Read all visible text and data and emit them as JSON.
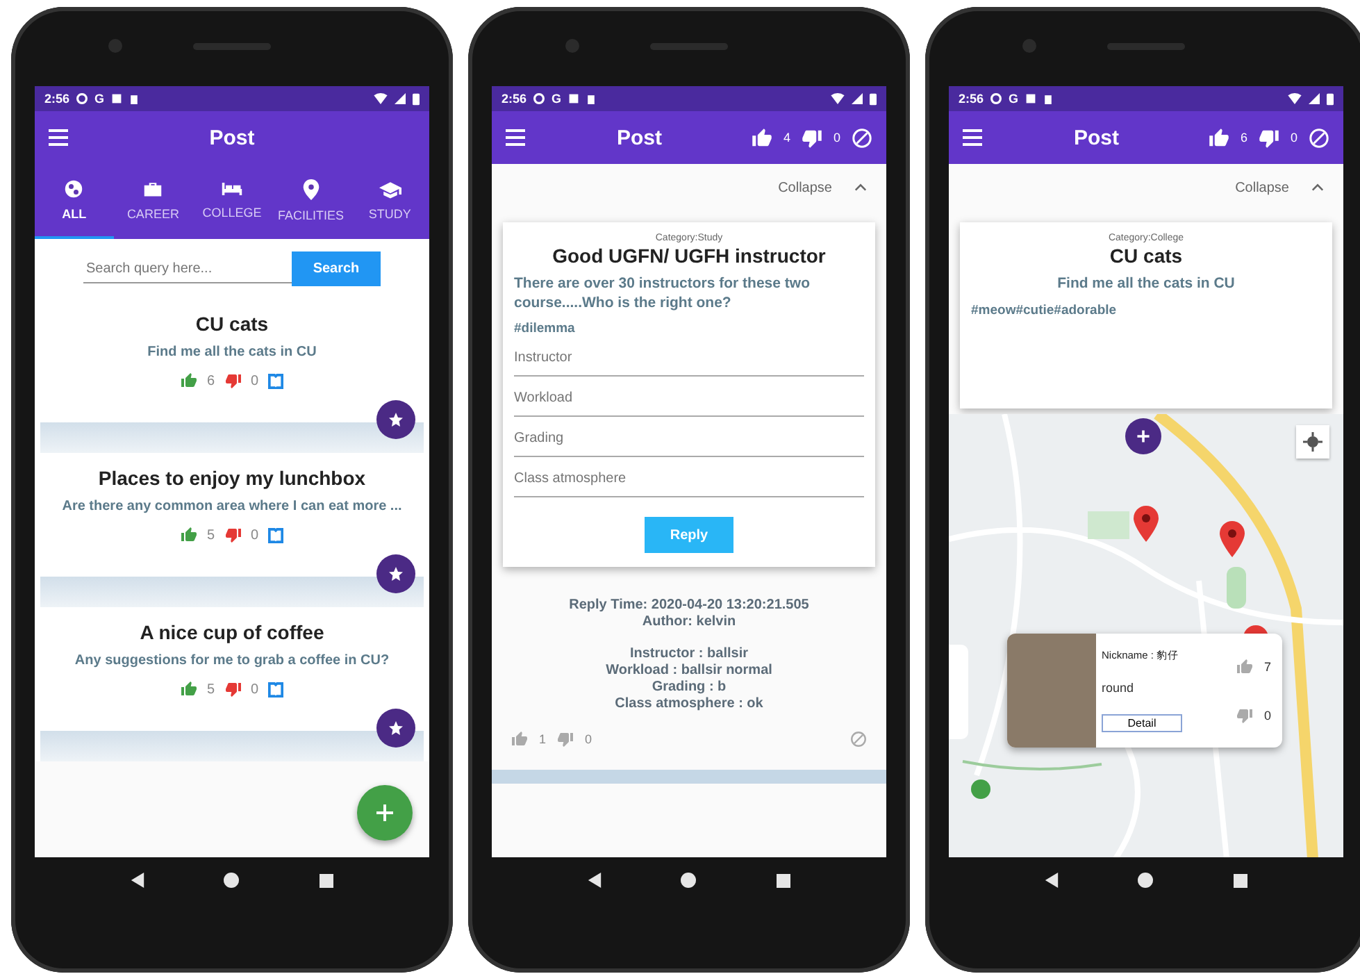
{
  "phones": [
    {
      "kind": "feed",
      "status_bar": {
        "time": "2:56",
        "letter": "G"
      },
      "app_bar": {
        "title": "Post"
      },
      "tabs": [
        {
          "label": "ALL",
          "selected": true
        },
        {
          "label": "CAREER",
          "selected": false
        },
        {
          "label": "COLLEGE",
          "selected": false
        },
        {
          "label": "FACILITIES",
          "selected": false
        },
        {
          "label": "STUDY",
          "selected": false
        }
      ],
      "search": {
        "placeholder": "Search query here...",
        "button": "Search"
      },
      "posts": [
        {
          "title": "CU cats",
          "body": "Find me all the cats in CU",
          "likes": "6",
          "dislikes": "0"
        },
        {
          "title": "Places to enjoy my lunchbox",
          "body": "Are there any common area where I can eat more ...",
          "likes": "5",
          "dislikes": "0"
        },
        {
          "title": "A nice cup of coffee",
          "body": "Any suggestions for me to grab a coffee in CU?",
          "likes": "5",
          "dislikes": "0"
        }
      ]
    },
    {
      "kind": "detail",
      "status_bar": {
        "time": "2:56",
        "letter": "G"
      },
      "app_bar": {
        "title": "Post",
        "likes": "4",
        "dislikes": "0"
      },
      "collapse": "Collapse",
      "post": {
        "category": "Category:Study",
        "title": "Good UGFN/ UGFH instructor",
        "body": "There are over 30 instructors for these two course.....Who is the right one?",
        "tags": "#dilemma"
      },
      "form": {
        "fields": [
          {
            "placeholder": "Instructor"
          },
          {
            "placeholder": "Workload"
          },
          {
            "placeholder": "Grading"
          },
          {
            "placeholder": "Class atmosphere"
          }
        ],
        "button": "Reply"
      },
      "reply": {
        "meta": [
          "Reply Time: 2020-04-20 13:20:21.505",
          "Author: kelvin"
        ],
        "answers": [
          "Instructor : ballsir",
          "Workload : ballsir normal",
          "Grading : b",
          "Class atmosphere : ok"
        ],
        "likes": "1",
        "dislikes": "0"
      }
    },
    {
      "kind": "map",
      "status_bar": {
        "time": "2:56",
        "letter": "G"
      },
      "app_bar": {
        "title": "Post",
        "likes": "6",
        "dislikes": "0"
      },
      "collapse": "Collapse",
      "post": {
        "category": "Category:College",
        "title": "CU cats",
        "body": "Find me all the cats in CU",
        "tags": "#meow#cutie#adorable"
      },
      "popup": {
        "nickname": "Nickname : 豹仔",
        "text": "round",
        "button": "Detail",
        "likes": "7",
        "dislikes": "0"
      }
    }
  ]
}
